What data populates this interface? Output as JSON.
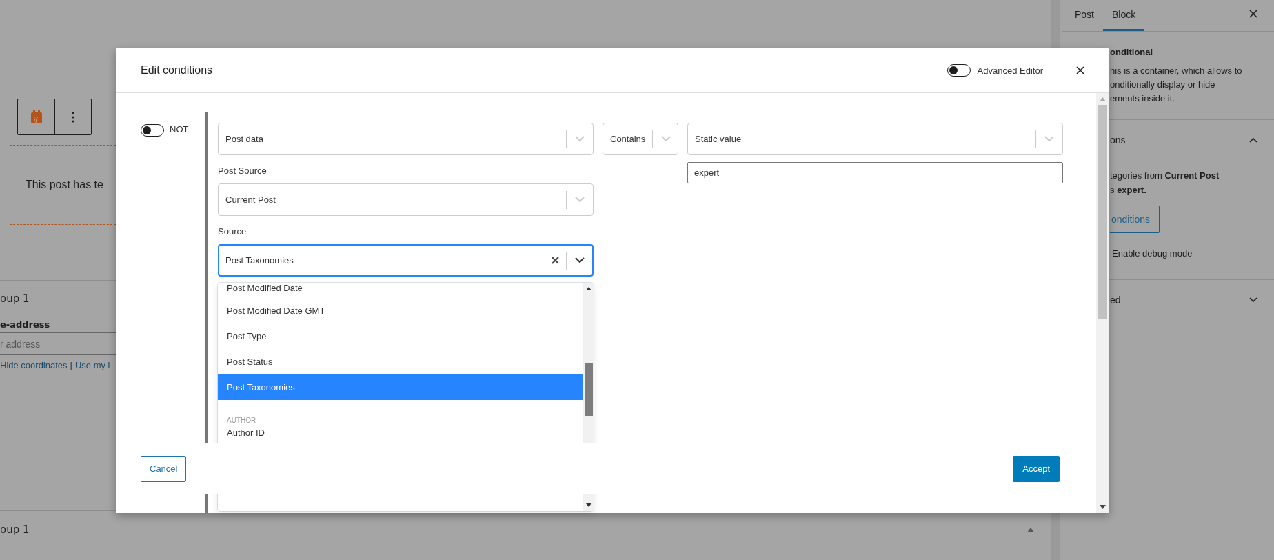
{
  "editor": {
    "block_icon_text": "if",
    "content_text": "This post has te",
    "group_1": {
      "title": "oup 1",
      "field_label": "e-address",
      "field_placeholder": "r address",
      "links": [
        "Hide coordinates",
        "Use my l"
      ],
      "link_separator": "|"
    },
    "group_2": {
      "title": "oup 1"
    }
  },
  "sidebar": {
    "tabs": [
      {
        "label": "Post",
        "selected": false
      },
      {
        "label": "Block",
        "selected": true
      }
    ],
    "block_name": "onditional",
    "block_description": [
      "his is a container, which allows to",
      "onditionally display or hide",
      "ements inside it."
    ],
    "panels": [
      {
        "title": "ons",
        "expanded": true,
        "summary": [
          "tegories from **Current Post**",
          "s **expert.**"
        ],
        "button": "onditions",
        "debug_label": "Enable debug mode"
      },
      {
        "title": "ed",
        "expanded": false
      }
    ]
  },
  "modal": {
    "title": "Edit conditions",
    "advanced_editor": {
      "label": "Advanced Editor",
      "on": false
    },
    "not_toggle": {
      "label": "NOT",
      "on": false
    },
    "data_select": {
      "value": "Post data"
    },
    "operator_select": {
      "value": "Contains"
    },
    "value_type_select": {
      "value": "Static value"
    },
    "value_input": {
      "value": "expert"
    },
    "post_source": {
      "label": "Post Source",
      "value": "Current Post"
    },
    "source": {
      "label": "Source",
      "value": "Post Taxonomies",
      "focused": true
    },
    "options": [
      {
        "kind": "option",
        "label": "Post Modified Date",
        "selected": false
      },
      {
        "kind": "option",
        "label": "Post Modified Date GMT",
        "selected": false
      },
      {
        "kind": "option",
        "label": "Post Type",
        "selected": false
      },
      {
        "kind": "option",
        "label": "Post Status",
        "selected": false
      },
      {
        "kind": "option",
        "label": "Post Taxonomies",
        "selected": true
      },
      {
        "kind": "group",
        "label": "AUTHOR"
      },
      {
        "kind": "option",
        "label": "Author ID",
        "selected": false
      }
    ],
    "buttons": {
      "cancel": "Cancel",
      "accept": "Accept"
    }
  }
}
